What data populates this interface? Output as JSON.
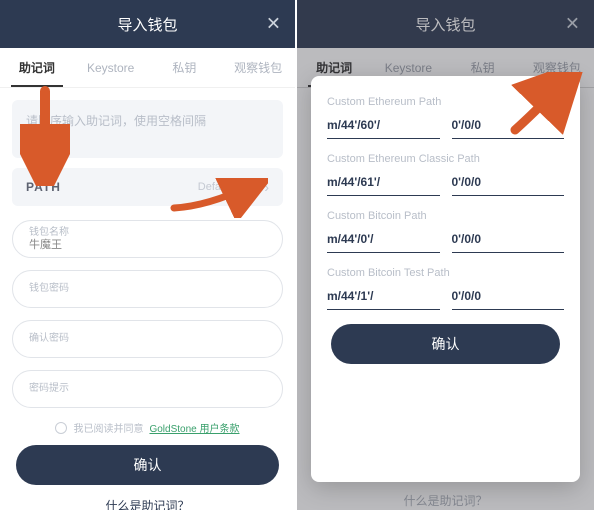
{
  "header": {
    "title": "导入钱包",
    "close_glyph": "✕"
  },
  "tabs": [
    "助记词",
    "Keystore",
    "私钥",
    "观察钱包"
  ],
  "left": {
    "mnemonic_placeholder": "请顺序输入助记词，使用空格间隔",
    "path_label": "PATH",
    "path_value": "Default Path",
    "fields": {
      "name_label": "钱包名称",
      "name_value": "牛魔王",
      "password_label": "钱包密码",
      "confirm_label": "确认密码",
      "hint_label": "密码提示"
    },
    "tos_prefix": "我已阅读并同意",
    "tos_link": "GoldStone 用户条款",
    "confirm_btn": "确认",
    "footer_link": "什么是助记词？"
  },
  "right": {
    "sheet": {
      "sections": [
        {
          "title": "Custom Ethereum Path",
          "prefix": "m/44'/60'/",
          "suffix": "0'/0/0"
        },
        {
          "title": "Custom Ethereum Classic Path",
          "prefix": "m/44'/61'/",
          "suffix": "0'/0/0"
        },
        {
          "title": "Custom Bitcoin Path",
          "prefix": "m/44'/0'/",
          "suffix": "0'/0/0"
        },
        {
          "title": "Custom Bitcoin Test Path",
          "prefix": "m/44'/1'/",
          "suffix": "0'/0/0"
        }
      ],
      "confirm_btn": "确认"
    },
    "confirm_btn_bg": "确认",
    "footer_link": "什么是助记词？"
  },
  "colors": {
    "primary": "#2d3a52",
    "accent_green": "#3aa06c",
    "arrow": "#d85a2a"
  }
}
